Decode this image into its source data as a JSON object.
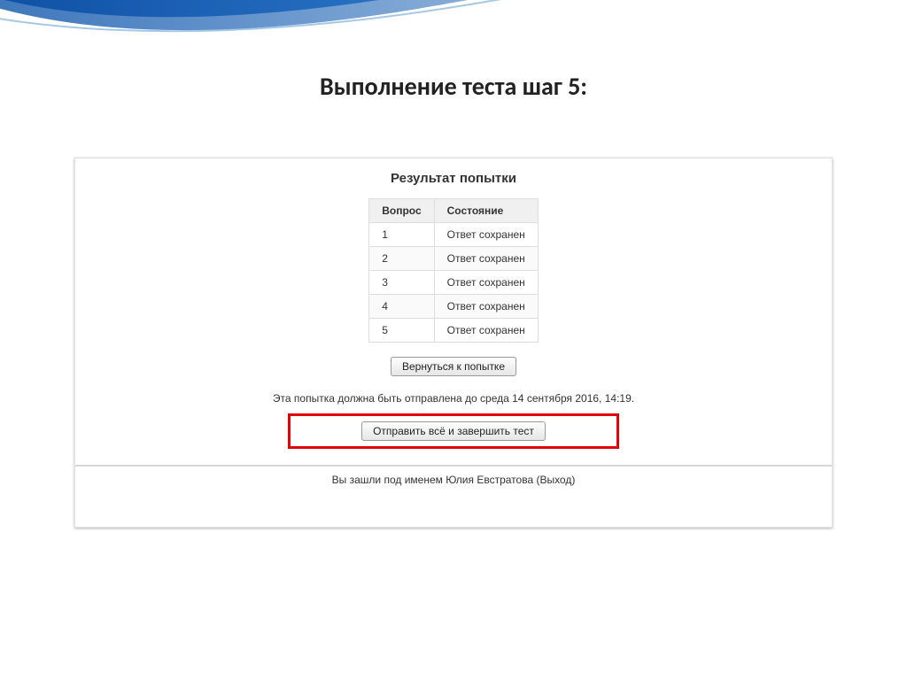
{
  "slide": {
    "title": "Выполнение  теста шаг 5:"
  },
  "attempt": {
    "heading": "Результат попытки",
    "columns": {
      "question": "Вопрос",
      "status": "Состояние"
    },
    "rows": [
      {
        "q": "1",
        "s": "Ответ сохранен"
      },
      {
        "q": "2",
        "s": "Ответ сохранен"
      },
      {
        "q": "3",
        "s": "Ответ сохранен"
      },
      {
        "q": "4",
        "s": "Ответ сохранен"
      },
      {
        "q": "5",
        "s": "Ответ сохранен"
      }
    ],
    "return_button": "Вернуться к попытке",
    "deadline": "Эта попытка должна быть отправлена до среда 14 сентября 2016, 14:19.",
    "submit_button": "Отправить всё и завершить тест",
    "footer": "Вы зашли под именем Юлия Евстратова (Выход)"
  }
}
